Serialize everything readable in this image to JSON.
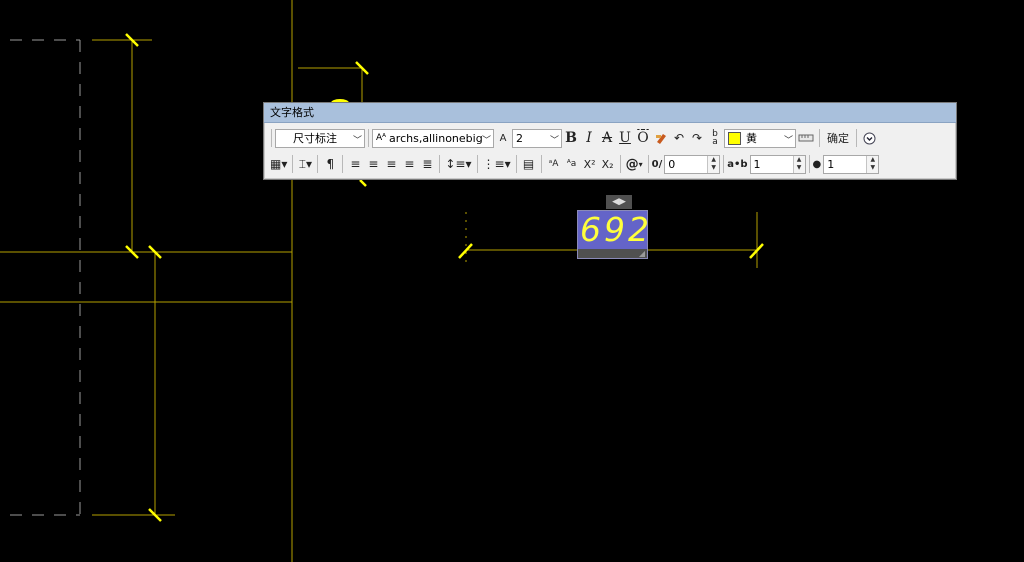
{
  "toolbar": {
    "title": "文字格式",
    "style": "尺寸标注",
    "font": "archs,allinonebig",
    "height": "2",
    "color_name": "黄",
    "ok": "确定",
    "oblique_value": "0",
    "tracking_value": "1",
    "width_value": "1",
    "height_icon_label": "A",
    "font_icon_label": "Aᴬ",
    "superscript_label": "X²",
    "subscript_label": "X₂",
    "symbol_label": "@",
    "oblique_label": "0/",
    "tracking_label": "a•b",
    "bold": "B",
    "italic": "I",
    "strike": "A",
    "underline": "U",
    "overline": "Ō"
  },
  "editor": {
    "text": "692"
  },
  "colors": {
    "drawing_line": "#b4a000",
    "tick": "#ffff00",
    "editor_bg": "#6464c8",
    "editor_text": "#ffff3c"
  }
}
